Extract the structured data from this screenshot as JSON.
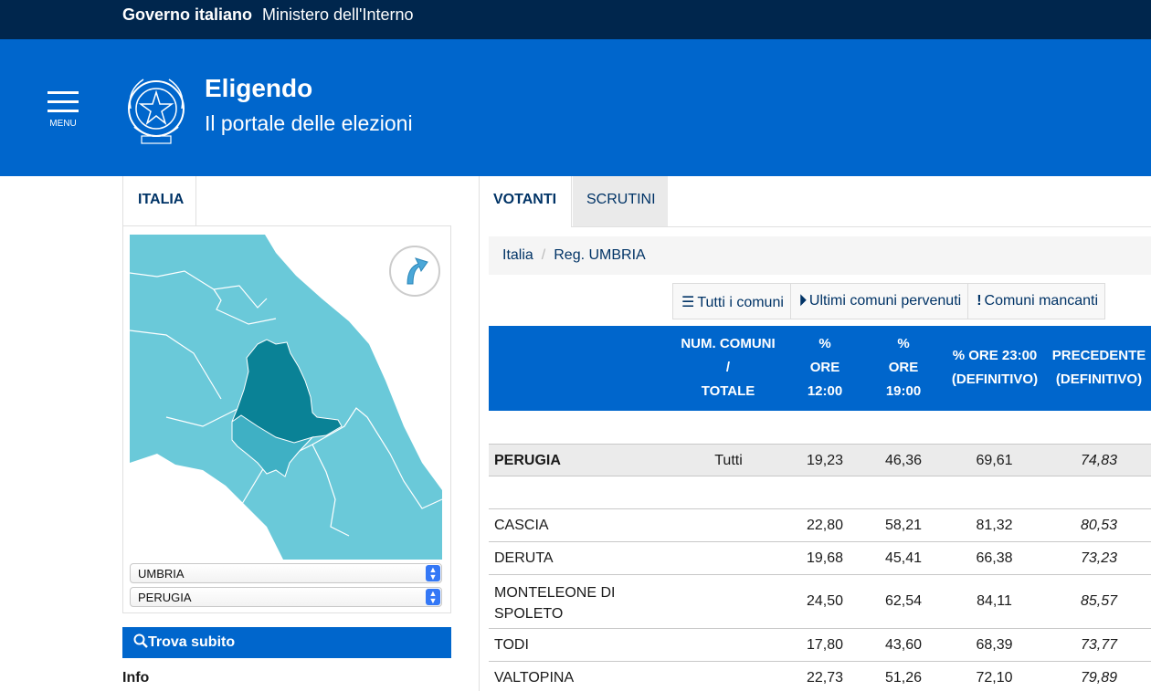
{
  "govbar": {
    "gov": "Governo italiano",
    "ministry": "Ministero dell'Interno"
  },
  "header": {
    "menu_label": "MENU",
    "title": "Eligendo",
    "subtitle": "Il portale delle elezioni",
    "emblem_icon": "italian-republic-emblem-icon"
  },
  "left": {
    "tab": "ITALIA",
    "selects": {
      "region": "UMBRIA",
      "province": "PERUGIA"
    },
    "search_label": "Trova subito",
    "info_label": "Info"
  },
  "tabs": {
    "votanti": "VOTANTI",
    "scrutini": "SCRUTINI"
  },
  "breadcrumb": {
    "root": "Italia",
    "current": "Reg. UMBRIA"
  },
  "actions": {
    "all": "Tutti i comuni",
    "last": "Ultimi comuni pervenuti",
    "missing": "Comuni mancanti"
  },
  "table": {
    "headers": {
      "num": [
        "NUM. COMUNI",
        "/",
        "TOTALE"
      ],
      "h12": [
        "%",
        "ORE",
        "12:00"
      ],
      "h19": [
        "%",
        "ORE",
        "19:00"
      ],
      "h23": [
        "% ORE 23:00",
        "(DEFINITIVO)"
      ],
      "prec": [
        "PRECEDENTE",
        "(DEFINITIVO)"
      ]
    },
    "total": {
      "name": "PERUGIA",
      "num": "Tutti",
      "h12": "19,23",
      "h19": "46,36",
      "h23": "69,61",
      "prec": "74,83"
    },
    "rows": [
      {
        "name": "CASCIA",
        "h12": "22,80",
        "h19": "58,21",
        "h23": "81,32",
        "prec": "80,53"
      },
      {
        "name": "DERUTA",
        "h12": "19,68",
        "h19": "45,41",
        "h23": "66,38",
        "prec": "73,23"
      },
      {
        "name_l1": "MONTELEONE DI",
        "name_l2": "SPOLETO",
        "h12": "24,50",
        "h19": "62,54",
        "h23": "84,11",
        "prec": "85,57"
      },
      {
        "name": "TODI",
        "h12": "17,80",
        "h19": "43,60",
        "h23": "68,39",
        "prec": "73,77"
      },
      {
        "name": "VALTOPINA",
        "h12": "22,73",
        "h19": "51,26",
        "h23": "72,10",
        "prec": "79,89"
      }
    ]
  },
  "colors": {
    "govbar": "#00264d",
    "primary": "#0066cc",
    "map_sea": "#ffffff",
    "map_land": "#6ac9d9",
    "map_umbria": "#0a8296"
  }
}
